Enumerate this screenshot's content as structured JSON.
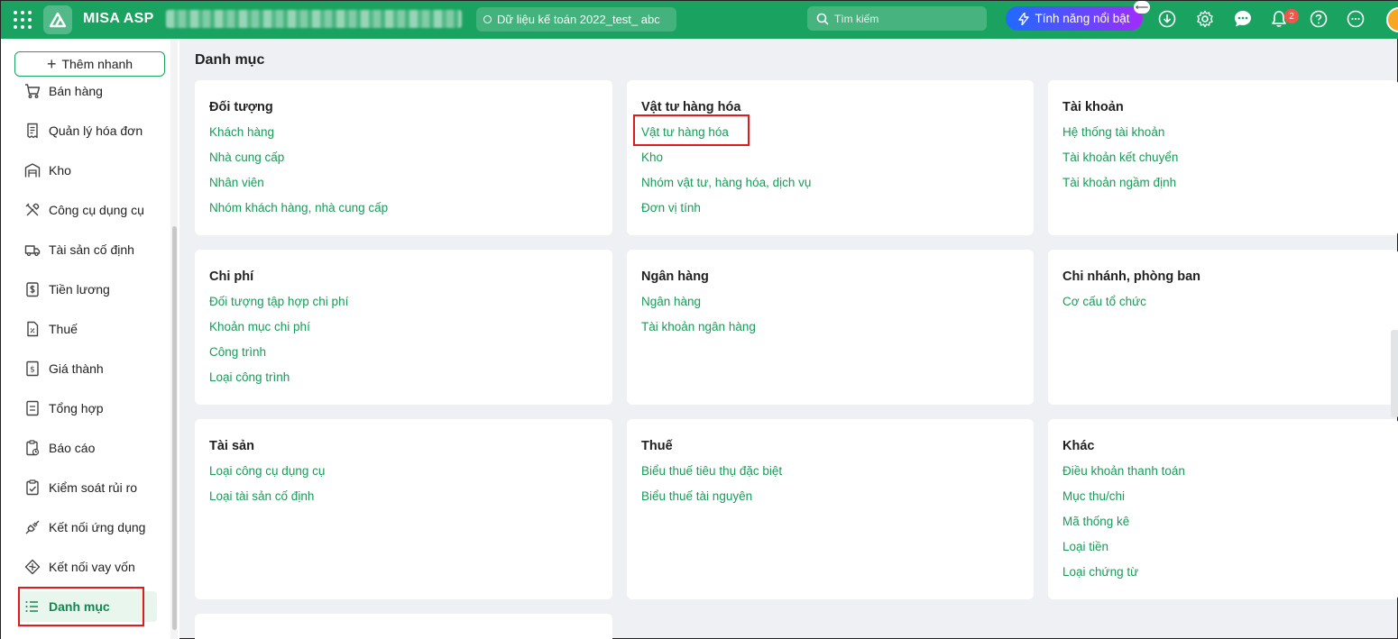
{
  "header": {
    "brand": "MISA ASP",
    "database_label": "Dữ liệu kế toán 2022_test_ abc",
    "search_placeholder": "Tìm kiếm",
    "feature_label": "Tính năng nổi bật",
    "notification_count": "2",
    "accent_color": "#1aa260"
  },
  "sidebar": {
    "add_label": "Thêm nhanh",
    "items": [
      {
        "label": "Bán hàng",
        "icon": "cart-icon"
      },
      {
        "label": "Quản lý hóa đơn",
        "icon": "invoice-icon"
      },
      {
        "label": "Kho",
        "icon": "warehouse-icon"
      },
      {
        "label": "Công cụ dụng cụ",
        "icon": "tools-icon"
      },
      {
        "label": "Tài sản cố định",
        "icon": "truck-icon"
      },
      {
        "label": "Tiền lương",
        "icon": "salary-icon"
      },
      {
        "label": "Thuế",
        "icon": "tax-icon"
      },
      {
        "label": "Giá thành",
        "icon": "cost-icon"
      },
      {
        "label": "Tổng hợp",
        "icon": "summary-icon"
      },
      {
        "label": "Báo cáo",
        "icon": "report-icon"
      },
      {
        "label": "Kiểm soát rủi ro",
        "icon": "risk-icon"
      },
      {
        "label": "Kết nối ứng dụng",
        "icon": "plug-icon"
      },
      {
        "label": "Kết nối vay vốn",
        "icon": "loan-icon"
      },
      {
        "label": "Danh mục",
        "icon": "list-icon"
      }
    ]
  },
  "main": {
    "title": "Danh mục",
    "cards": [
      {
        "title": "Đối tượng",
        "links": [
          "Khách hàng",
          "Nhà cung cấp",
          "Nhân viên",
          "Nhóm khách hàng, nhà cung cấp"
        ]
      },
      {
        "title": "Vật tư hàng hóa",
        "links": [
          "Vật tư hàng hóa",
          "Kho",
          "Nhóm vật tư, hàng hóa, dịch vụ",
          "Đơn vị tính"
        ]
      },
      {
        "title": "Tài khoản",
        "links": [
          "Hệ thống tài khoản",
          "Tài khoản kết chuyển",
          "Tài khoản ngầm định"
        ]
      },
      {
        "title": "Chi phí",
        "links": [
          "Đối tượng tập hợp chi phí",
          "Khoản mục chi phí",
          "Công trình",
          "Loại công trình"
        ]
      },
      {
        "title": "Ngân hàng",
        "links": [
          "Ngân hàng",
          "Tài khoản ngân hàng"
        ]
      },
      {
        "title": "Chi nhánh, phòng ban",
        "links": [
          "Cơ cấu tổ chức"
        ]
      },
      {
        "title": "Tài sản",
        "links": [
          "Loại công cụ dụng cụ",
          "Loại tài sản cố định"
        ]
      },
      {
        "title": "Thuế",
        "links": [
          "Biểu thuế tiêu thụ đặc biệt",
          "Biểu thuế tài nguyên"
        ]
      },
      {
        "title": "Khác",
        "links": [
          "Điều khoản thanh toán",
          "Mục thu/chi",
          "Mã thống kê",
          "Loại tiền",
          "Loại chứng từ"
        ]
      }
    ]
  }
}
